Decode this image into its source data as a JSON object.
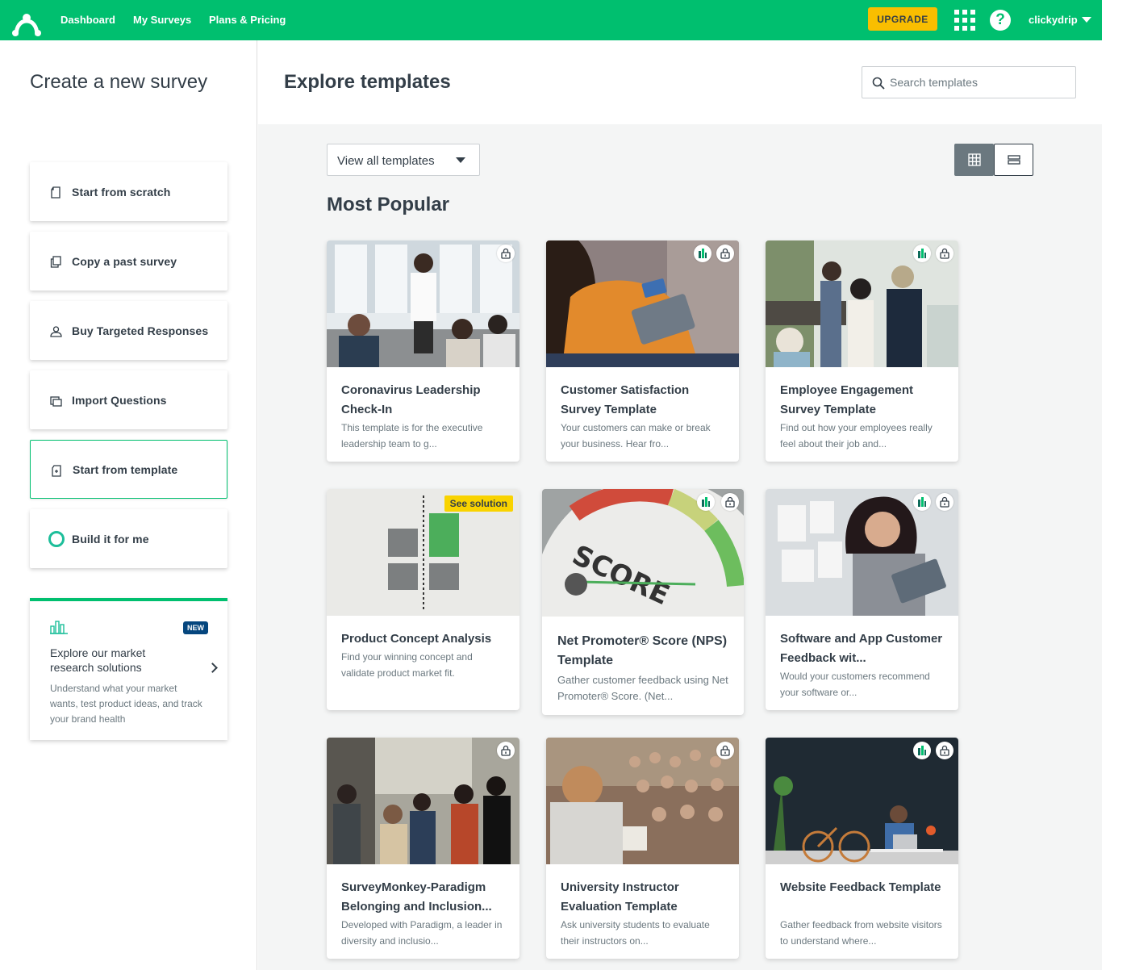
{
  "nav": {
    "links": [
      "Dashboard",
      "My Surveys",
      "Plans & Pricing"
    ],
    "upgrade": "UPGRADE",
    "help": "?",
    "username": "clickydrip"
  },
  "left": {
    "title": "Create a new survey",
    "options": [
      {
        "label": "Start from scratch",
        "icon": "page-icon"
      },
      {
        "label": "Copy a past survey",
        "icon": "copy-icon"
      },
      {
        "label": "Buy Targeted Responses",
        "icon": "person-icon"
      },
      {
        "label": "Import Questions",
        "icon": "import-icon"
      },
      {
        "label": "Start from template",
        "icon": "template-icon"
      },
      {
        "label": "Build it for me",
        "icon": "ring-icon"
      }
    ],
    "market": {
      "badge": "NEW",
      "title": "Explore our market research solutions",
      "desc": "Understand what your market wants, test product ideas, and track your brand health"
    }
  },
  "right": {
    "title": "Explore templates",
    "search_placeholder": "Search templates",
    "filter": "View all templates",
    "section": "Most Popular"
  },
  "cards": [
    {
      "title": "Coronavirus Leadership Check-In",
      "desc": "This template is for the executive leadership team to g..."
    },
    {
      "title": "Customer Satisfaction Survey Template",
      "desc": "Your customers can make or break your business. Hear fro..."
    },
    {
      "title": "Employee Engagement Survey Template",
      "desc": "Find out how your employees really feel about their job and..."
    },
    {
      "title": "Product Concept Analysis",
      "desc": "Find your winning concept and validate product market fit.",
      "tag": "See solution"
    },
    {
      "title": "Net Promoter® Score (NPS) Template",
      "desc": "Gather customer feedback using Net Promoter® Score. (Net..."
    },
    {
      "title": "Software and App Customer Feedback wit...",
      "desc": "Would your customers recommend your software or..."
    },
    {
      "title": "SurveyMonkey-Paradigm Belonging and Inclusion...",
      "desc": "Developed with Paradigm, a leader in diversity and inclusio..."
    },
    {
      "title": "University Instructor Evaluation Template",
      "desc": "Ask university students to evaluate their instructors on..."
    },
    {
      "title": "Website Feedback Template",
      "desc": "Gather feedback from website visitors to understand where..."
    }
  ],
  "colors": {
    "brand": "#00bf6f",
    "upgrade": "#f9be00",
    "text": "#333e48",
    "muted": "#6b787f"
  }
}
